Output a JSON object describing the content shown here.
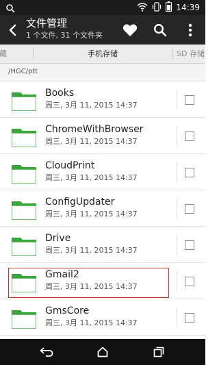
{
  "status_bar": {
    "time": "14:39",
    "icons": [
      "search-icon",
      "wifi-icon",
      "vibrate-icon",
      "battery-icon"
    ]
  },
  "header": {
    "title": "文件管理",
    "subtitle": "1 个文件, 31 个文件夹",
    "icons": [
      "back-icon",
      "favorite-heart-icon",
      "search-icon",
      "overflow-menu-icon"
    ]
  },
  "tabs": [
    {
      "label": "收藏"
    },
    {
      "label": "手机存储"
    },
    {
      "label": "SD 存储"
    }
  ],
  "path": "/HGC/ptt",
  "files": [
    {
      "name": "Books",
      "date": "周三, 3月 11, 2015 14:37"
    },
    {
      "name": "ChromeWithBrowser",
      "date": "周三, 3月 11, 2015 14:37"
    },
    {
      "name": "CloudPrint",
      "date": "周三, 3月 11, 2015 14:37"
    },
    {
      "name": "ConfigUpdater",
      "date": "周三, 3月 11, 2015 14:37"
    },
    {
      "name": "Drive",
      "date": "周三, 3月 11, 2015 14:37"
    },
    {
      "name": "Gmail2",
      "date": "周三, 3月 11, 2015 14:37"
    },
    {
      "name": "GmsCore",
      "date": "周三, 3月 11, 2015 14:37"
    }
  ],
  "colors": {
    "action_bar": "#262626",
    "folder_green": "#3aa53a",
    "highlight_border": "#c0392b"
  },
  "nav": [
    "back-icon",
    "home-icon",
    "recent-apps-icon"
  ]
}
